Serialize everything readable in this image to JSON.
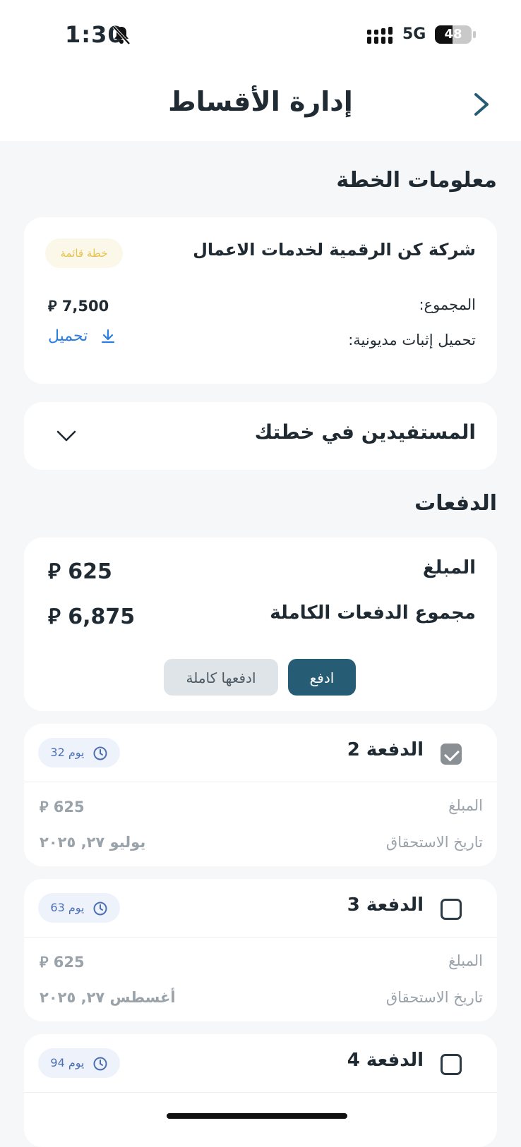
{
  "status_bar": {
    "time": "1:30",
    "network": "5G",
    "battery": "48",
    "battery_level": 0.48
  },
  "header": {
    "title": "إدارة الأقساط"
  },
  "plan_info": {
    "section_title": "معلومات الخطة",
    "company": "شركة كن الرقمية لخدمات الاعمال",
    "status_badge": "خطة قائمة",
    "total_label": "المجموع:",
    "total_value": "7,500",
    "debt_proof_label": "تحميل إثبات مديونية:",
    "download_label": "تحميل"
  },
  "beneficiaries": {
    "title": "المستفيدين في خطتك"
  },
  "payments": {
    "section_title": "الدفعات",
    "amount_label": "المبلغ",
    "amount_value": "625",
    "full_total_label": "مجموع الدفعات الكاملة",
    "full_total_value": "6,875",
    "pay_button": "ادفع",
    "pay_all_button": "ادفعها كاملة"
  },
  "currency_symbol": "⃁",
  "installments": [
    {
      "title": "الدفعة 2",
      "checked": true,
      "days": "32 يوم",
      "amount_label": "المبلغ",
      "amount": "625",
      "due_label": "تاريخ الاستحقاق",
      "due_date": "يوليو ٢٧, ٢٠٢٥"
    },
    {
      "title": "الدفعة 3",
      "checked": false,
      "days": "63 يوم",
      "amount_label": "المبلغ",
      "amount": "625",
      "due_label": "تاريخ الاستحقاق",
      "due_date": "أغسطس ٢٧, ٢٠٢٥"
    },
    {
      "title": "الدفعة 4",
      "checked": false,
      "days": "94 يوم"
    }
  ],
  "colors": {
    "primary": "#265d74",
    "link": "#2a7de1",
    "badge_text": "#e6c24a",
    "days_badge_text": "#4b6fb7",
    "background": "#f6f7f8"
  }
}
